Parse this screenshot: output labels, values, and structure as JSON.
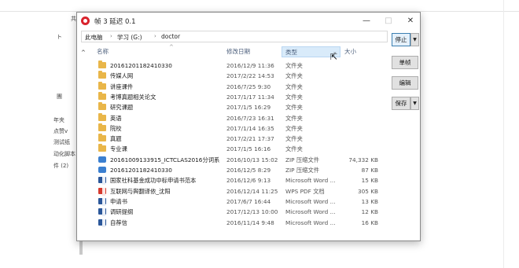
{
  "background": {
    "top_label": "共",
    "left_items": [
      "ト",
      "團",
      "年夹",
      "点赞v",
      "测试纸",
      "动化脚本",
      "件 (2)"
    ]
  },
  "dialog": {
    "title": "帧 3 延迟 0.1",
    "window_controls": {
      "minimize": "—",
      "maximize": "□",
      "close": "✕"
    },
    "breadcrumb": [
      "此电脑",
      "学习 (G:)",
      "doctor"
    ],
    "columns": {
      "name": "名称",
      "date": "修改日期",
      "type": "类型",
      "size": "大小"
    },
    "files": [
      {
        "name": "20161201182410330",
        "date": "2016/12/9 11:36",
        "type": "文件夹",
        "size": "",
        "icon": "folder-icon"
      },
      {
        "name": "传媒人网",
        "date": "2017/2/22 14:53",
        "type": "文件夹",
        "size": "",
        "icon": "folder-icon"
      },
      {
        "name": "讲座课件",
        "date": "2016/7/25 9:30",
        "type": "文件夹",
        "size": "",
        "icon": "folder-icon"
      },
      {
        "name": "考博真题相关论文",
        "date": "2017/1/17 11:34",
        "type": "文件夹",
        "size": "",
        "icon": "folder-icon"
      },
      {
        "name": "研究课题",
        "date": "2017/1/5 16:29",
        "type": "文件夹",
        "size": "",
        "icon": "folder-icon"
      },
      {
        "name": "英语",
        "date": "2016/7/23 16:31",
        "type": "文件夹",
        "size": "",
        "icon": "folder-icon"
      },
      {
        "name": "院校",
        "date": "2017/1/14 16:35",
        "type": "文件夹",
        "size": "",
        "icon": "folder-icon"
      },
      {
        "name": "真题",
        "date": "2017/2/21 17:37",
        "type": "文件夹",
        "size": "",
        "icon": "folder-icon"
      },
      {
        "name": "专业课",
        "date": "2017/1/5 16:16",
        "type": "文件夹",
        "size": "",
        "icon": "folder-icon"
      },
      {
        "name": "20161009133915_ICTCLAS2016分词系...",
        "date": "2016/10/13 15:02",
        "type": "ZIP 压缩文件",
        "size": "74,332 KB",
        "icon": "zip-icon"
      },
      {
        "name": "20161201182410330",
        "date": "2016/12/5 8:29",
        "type": "ZIP 压缩文件",
        "size": "87 KB",
        "icon": "zip-icon"
      },
      {
        "name": "国家社科基金成功中标申请书范本",
        "date": "2016/12/6 9:13",
        "type": "Microsoft Word ...",
        "size": "15 KB",
        "icon": "word-icon"
      },
      {
        "name": "互联网与舆翻译依_沈阳",
        "date": "2016/12/14 11:25",
        "type": "WPS PDF 文档",
        "size": "305 KB",
        "icon": "pdf-icon"
      },
      {
        "name": "申请书",
        "date": "2017/6/7 16:44",
        "type": "Microsoft Word ...",
        "size": "13 KB",
        "icon": "word-icon"
      },
      {
        "name": "调研提纲",
        "date": "2017/12/13 10:00",
        "type": "Microsoft Word ...",
        "size": "12 KB",
        "icon": "word-icon"
      },
      {
        "name": "自荐信",
        "date": "2016/11/14 9:48",
        "type": "Microsoft Word ...",
        "size": "16 KB",
        "icon": "word-icon"
      }
    ],
    "buttons": {
      "stop": "停止",
      "step": "单帧",
      "edit": "编辑",
      "save": "保存"
    }
  }
}
